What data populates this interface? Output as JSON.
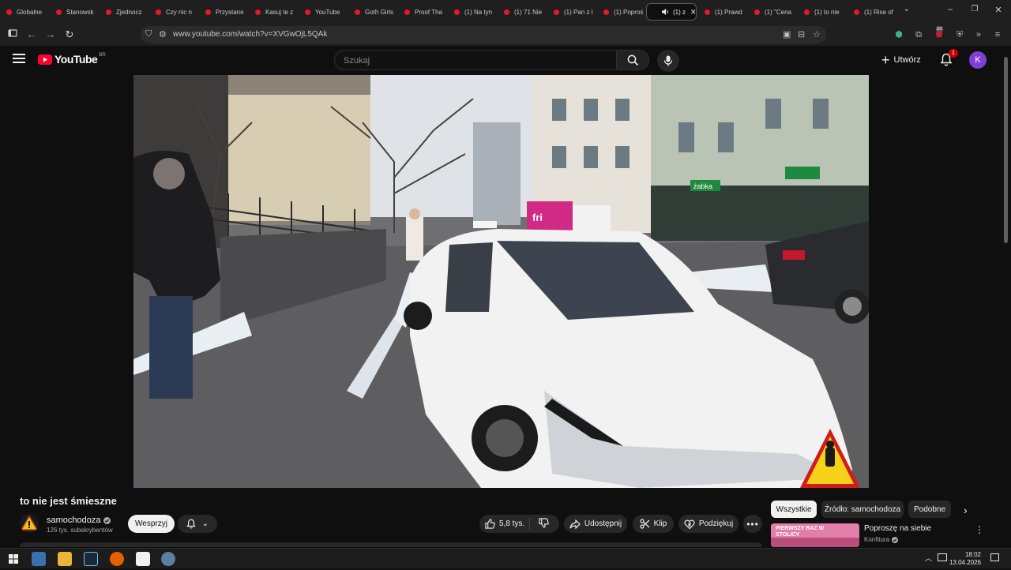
{
  "browser": {
    "tabs": [
      {
        "label": "Globalne"
      },
      {
        "label": "Stanowsk"
      },
      {
        "label": "Zjednocz"
      },
      {
        "label": "Czy nic n"
      },
      {
        "label": "Przystane"
      },
      {
        "label": "Kasuj te z"
      },
      {
        "label": "YouTube"
      },
      {
        "label": "Goth Girls"
      },
      {
        "label": "Proof Tha"
      },
      {
        "label": "(1) Na tyn"
      },
      {
        "label": "(1) 71 Nie"
      },
      {
        "label": "(1) Pan z l"
      },
      {
        "label": "(1) Poproś"
      },
      {
        "label": "(1) z"
      },
      {
        "label": "(1) Prawd"
      },
      {
        "label": "(1) \"Cena"
      },
      {
        "label": "(1) to nie"
      },
      {
        "label": "(1) Rise of"
      }
    ],
    "url": "www.youtube.com/watch?v=XVGwOjL5QAk",
    "extension_badge": "20"
  },
  "youtube": {
    "logo_text": "YouTube",
    "region": "BR",
    "search_placeholder": "Szukaj",
    "create_label": "Utwórz",
    "notification_count": "1",
    "avatar_letter": "K"
  },
  "video": {
    "title": "to nie jest śmieszne",
    "sign_text": "żabka",
    "van_text": "fri"
  },
  "channel": {
    "name": "samochodoza",
    "subscribers": "126 tys. subskrybentów",
    "support_label": "Wesprzyj"
  },
  "actions": {
    "likes": "5,8 tys.",
    "share": "Udostępnij",
    "clip": "Klip",
    "thanks": "Podziękuj"
  },
  "chips": [
    "Wszystkie",
    "Źródło: samochodoza",
    "Podobne"
  ],
  "recommendation": {
    "title": "Poproszę na siebie",
    "channel": "Konfitura",
    "thumb_text": "PIERWSZY RAZ W STOLICY"
  },
  "taskbar": {
    "time": "18:02",
    "date": "13.04.2026"
  },
  "colors": {
    "youtube_red": "#ff0033",
    "avatar_purple": "#7e3fd6",
    "background": "#0f0f0f"
  }
}
